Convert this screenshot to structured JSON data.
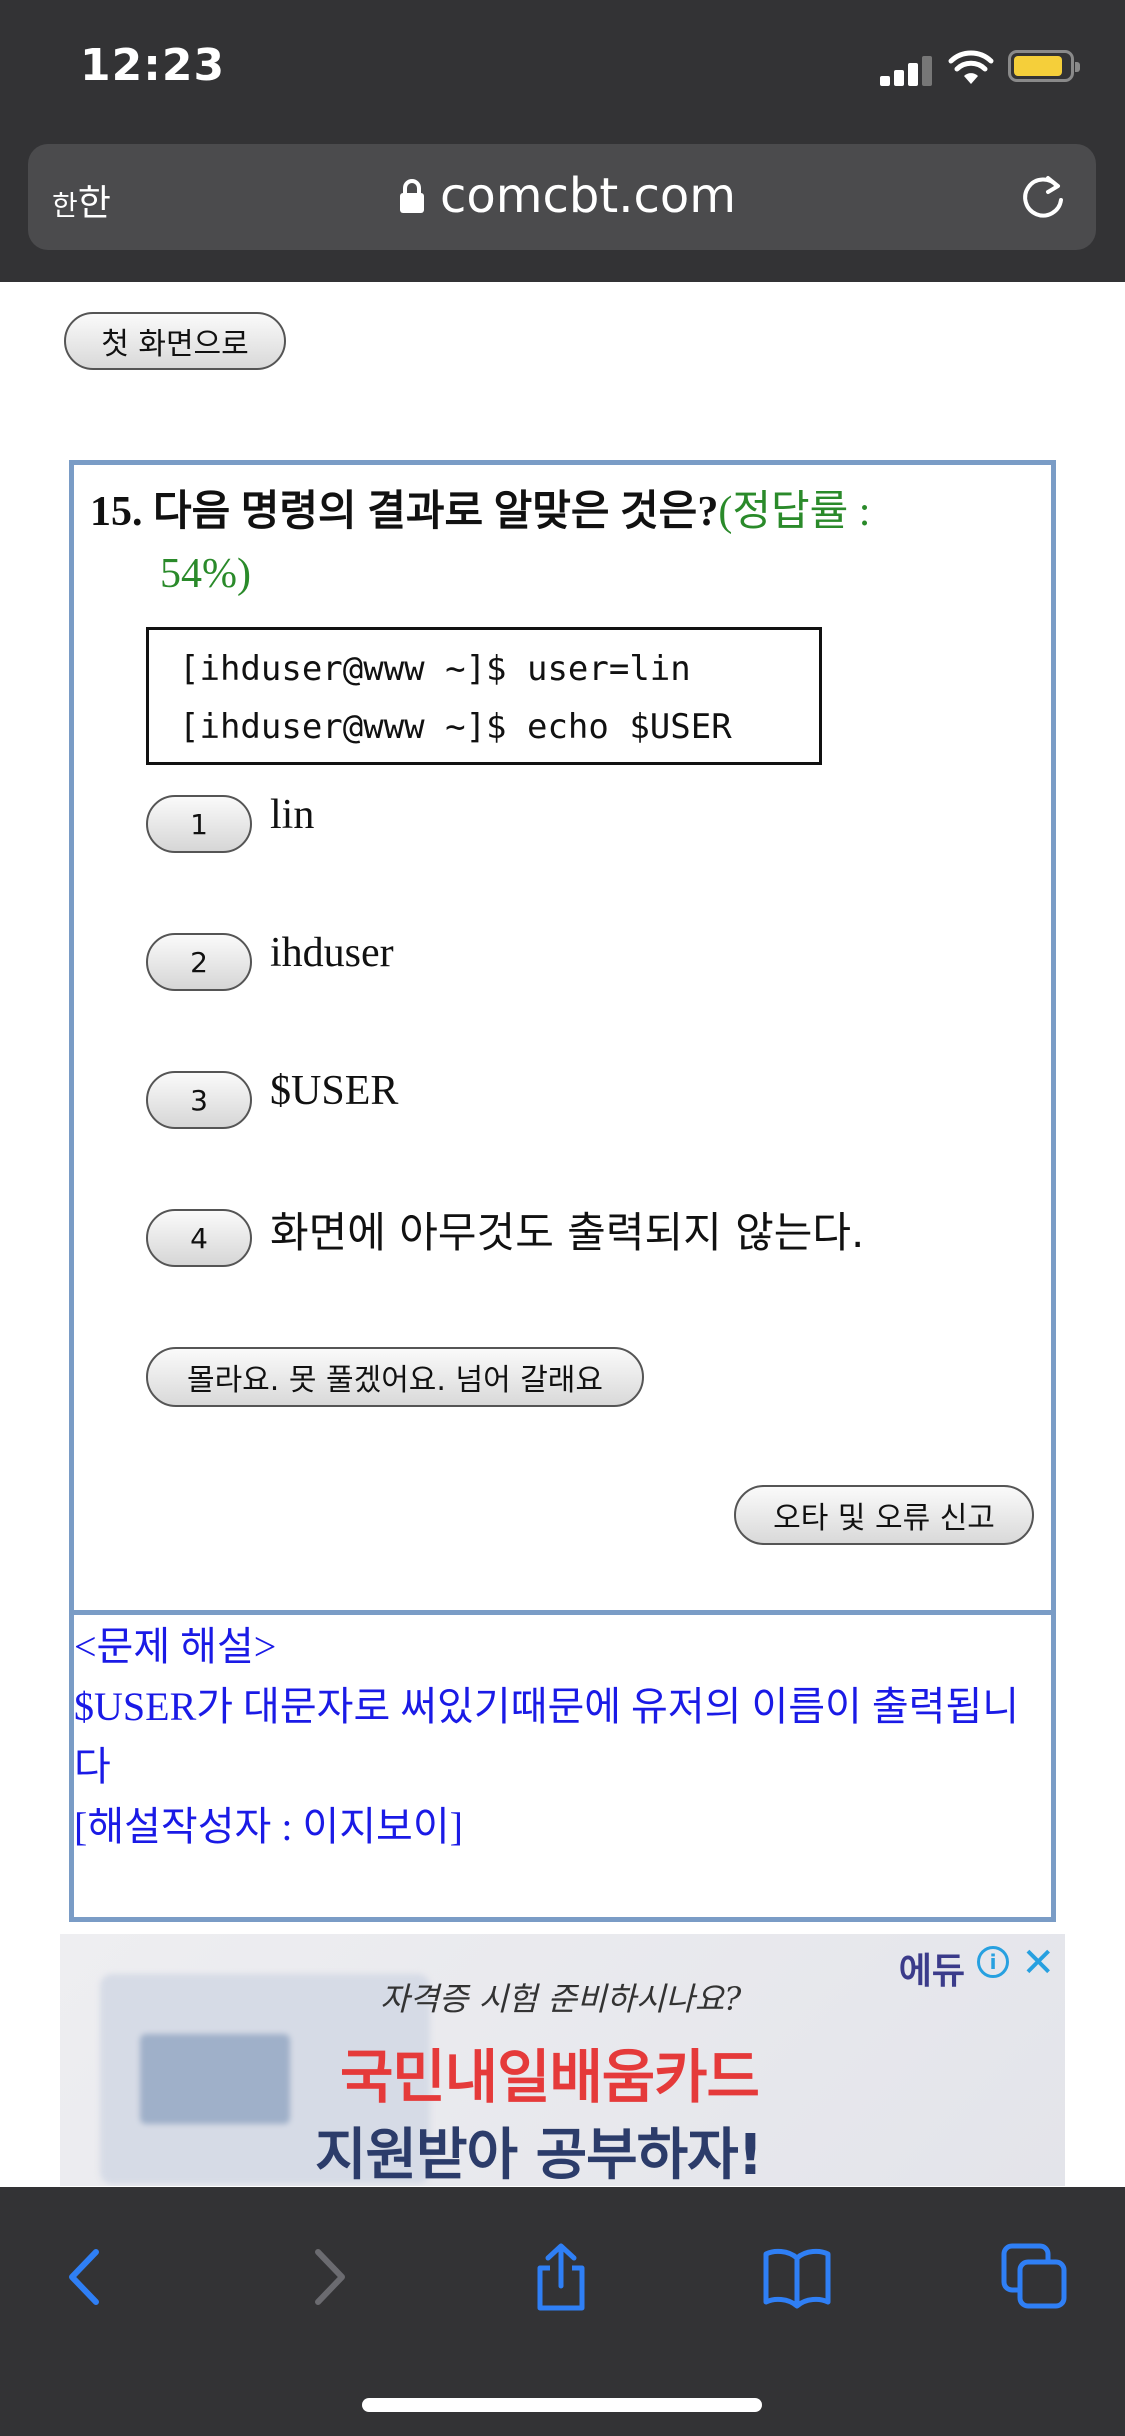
{
  "status_bar": {
    "time": "12:23"
  },
  "address_bar": {
    "text_size_label_large": "한",
    "text_size_label_small": "한",
    "domain": "comcbt.com"
  },
  "page": {
    "home_button": "첫 화면으로",
    "question": {
      "number_and_text": "15. 다음 명령의 결과로 알맞은 것은?",
      "rate_label": "(정답률 :",
      "rate_value": "54%)",
      "code_lines": [
        "[ihduser@www ~]$ user=lin",
        "[ihduser@www ~]$ echo $USER"
      ],
      "choices": [
        {
          "num": "1",
          "text": "lin"
        },
        {
          "num": "2",
          "text": "ihduser"
        },
        {
          "num": "3",
          "text": "$USER"
        },
        {
          "num": "4",
          "text": "화면에 아무것도 출력되지 않는다."
        }
      ],
      "skip_button": "몰라요. 못 풀겠어요. 넘어 갈래요",
      "report_button": "오타 및 오류 신고"
    },
    "explanation": {
      "header": "<문제 해설>",
      "body": "$USER가 대문자로 써있기때문에 유저의 이름이 출력됩니다",
      "author": "[해설작성자 : 이지보이]"
    },
    "ad": {
      "brand": "에듀",
      "line1": "자격증 시험 준비하시나요?",
      "line2": "국민내일배움카드",
      "line3": "지원받아 공부하자!"
    }
  },
  "colors": {
    "chrome": "#333335",
    "box_border": "#7a9cc6",
    "rate_green": "#2a8a2a",
    "explanation_blue": "#1a1ae6",
    "toolbar_blue": "#2f7ff5"
  },
  "toolbar": {
    "icons": [
      "back-icon",
      "forward-icon",
      "share-icon",
      "bookmarks-icon",
      "tabs-icon"
    ]
  }
}
